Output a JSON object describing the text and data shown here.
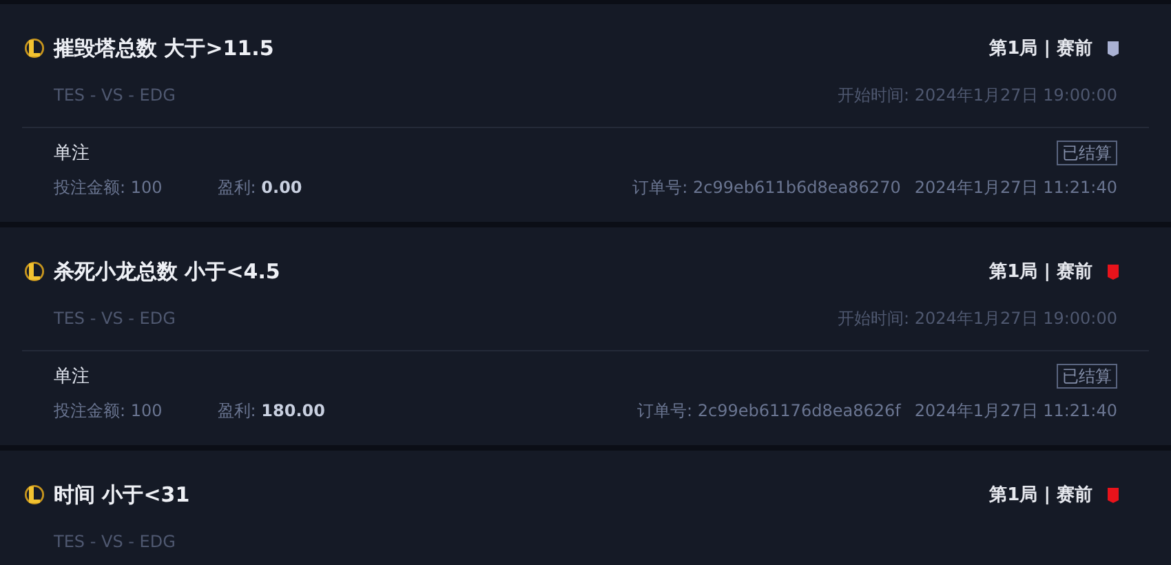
{
  "bets": [
    {
      "title": "摧毁塔总数 大于>11.5",
      "match": "TES - VS - EDG",
      "round": "第1局 | 赛前",
      "color": "#a9b1d3",
      "start_time": "开始时间: 2024年1月27日 19:00:00",
      "bet_type": "单注",
      "status": "已结算",
      "amount_label": "投注金额:",
      "amount": "100",
      "profit_label": "盈利:",
      "profit": "0.00",
      "order": "订单号: 2c99eb611b6d8ea86270",
      "placed_time": "2024年1月27日 11:21:40"
    },
    {
      "title": "杀死小龙总数 小于<4.5",
      "match": "TES - VS - EDG",
      "round": "第1局 | 赛前",
      "color": "#e8131b",
      "start_time": "开始时间: 2024年1月27日 19:00:00",
      "bet_type": "单注",
      "status": "已结算",
      "amount_label": "投注金额:",
      "amount": "100",
      "profit_label": "盈利:",
      "profit": "180.00",
      "order": "订单号: 2c99eb61176d8ea8626f",
      "placed_time": "2024年1月27日 11:21:40"
    },
    {
      "title": "时间 小于<31",
      "match": "TES - VS - EDG",
      "round": "第1局 | 赛前",
      "color": "#e8131b"
    }
  ]
}
